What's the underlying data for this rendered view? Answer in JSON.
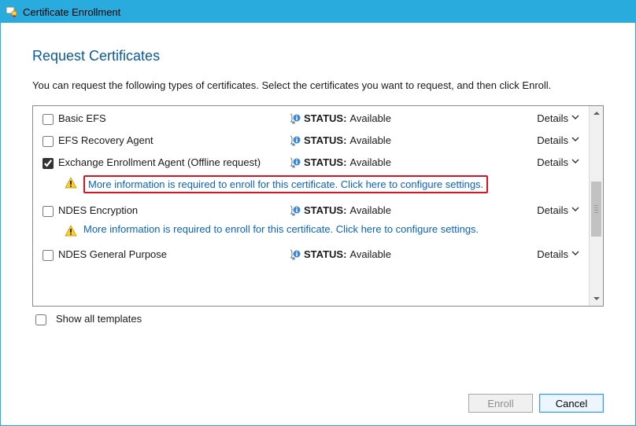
{
  "window": {
    "title": "Certificate Enrollment"
  },
  "page": {
    "heading": "Request Certificates",
    "instructions": "You can request the following types of certificates. Select the certificates you want to request, and then click Enroll."
  },
  "status_prefix": "STATUS:",
  "details_label": "Details",
  "config_link_text": "More information is required to enroll for this certificate. Click here to configure settings.",
  "certs": [
    {
      "name": "Basic EFS",
      "status": "Available",
      "checked": false,
      "warn": false
    },
    {
      "name": "EFS Recovery Agent",
      "status": "Available",
      "checked": false,
      "warn": false
    },
    {
      "name": "Exchange Enrollment Agent (Offline request)",
      "status": "Available",
      "checked": true,
      "warn": true,
      "warn_highlighted": true
    },
    {
      "name": "NDES Encryption",
      "status": "Available",
      "checked": false,
      "warn": true,
      "warn_highlighted": false
    },
    {
      "name": "NDES General Purpose",
      "status": "Available",
      "checked": false,
      "warn": false
    }
  ],
  "show_all_label": "Show all templates",
  "buttons": {
    "enroll": "Enroll",
    "cancel": "Cancel"
  }
}
